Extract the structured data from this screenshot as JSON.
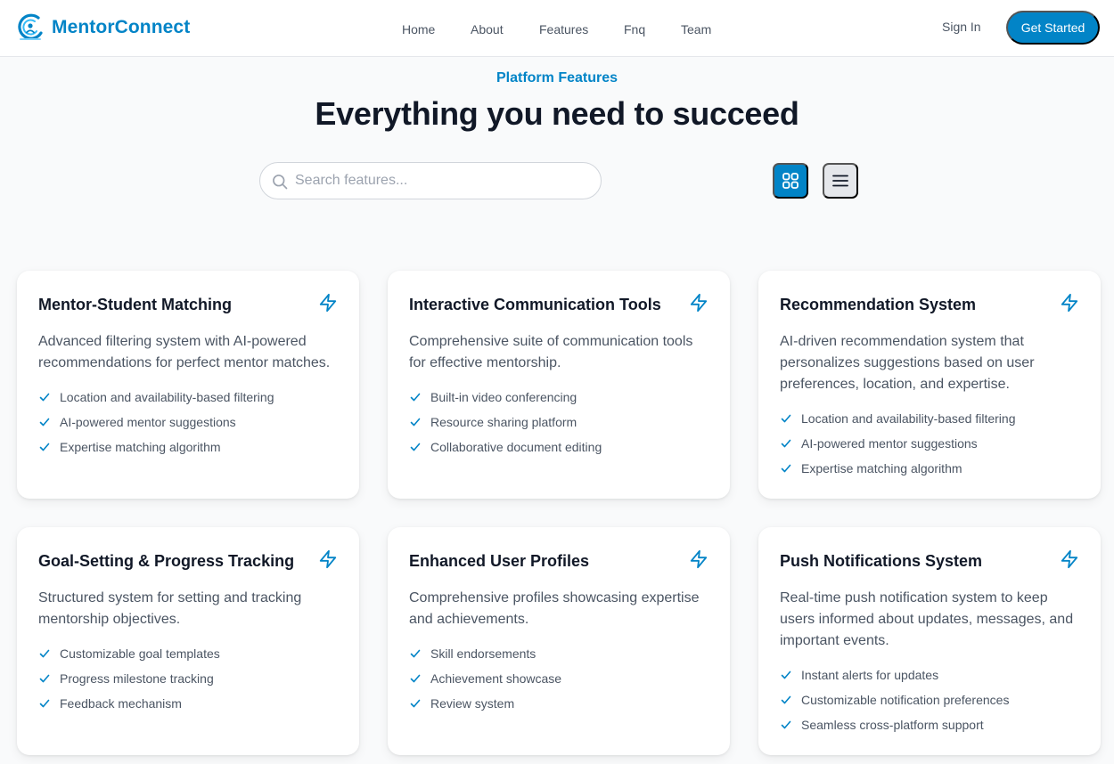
{
  "brand": {
    "name": "MentorConnect",
    "logo_icon": "mentorconnect-logo-icon"
  },
  "nav": {
    "links": [
      "Home",
      "About",
      "Features",
      "Fnq",
      "Team"
    ],
    "sign_in": "Sign In",
    "cta": "Get Started"
  },
  "section": {
    "eyebrow": "Platform Features",
    "title": "Everything you need to succeed"
  },
  "search": {
    "placeholder": "Search features...",
    "value": ""
  },
  "view_toggle": {
    "active": "grid",
    "options": [
      "grid",
      "list"
    ]
  },
  "colors": {
    "accent": "#0284c7",
    "heading": "#111827",
    "body_text": "#4b5563",
    "page_bg": "#f9fafb",
    "card_bg": "#ffffff",
    "toggle_inactive": "#e5e7eb"
  },
  "features": [
    {
      "title": "Mentor-Student Matching",
      "icon": "lightning-bolt-icon",
      "description": "Advanced filtering system with AI-powered recommendations for perfect mentor matches.",
      "items": [
        "Location and availability-based filtering",
        "AI-powered mentor suggestions",
        "Expertise matching algorithm"
      ]
    },
    {
      "title": "Interactive Communication Tools",
      "icon": "lightning-bolt-icon",
      "description": "Comprehensive suite of communication tools for effective mentorship.",
      "items": [
        "Built-in video conferencing",
        "Resource sharing platform",
        "Collaborative document editing"
      ]
    },
    {
      "title": "Recommendation System",
      "icon": "lightning-bolt-icon",
      "description": "AI-driven recommendation system that personalizes suggestions based on user preferences, location, and expertise.",
      "items": [
        "Location and availability-based filtering",
        "AI-powered mentor suggestions",
        "Expertise matching algorithm"
      ]
    },
    {
      "title": "Goal-Setting & Progress Tracking",
      "icon": "lightning-bolt-icon",
      "description": "Structured system for setting and tracking mentorship objectives.",
      "items": [
        "Customizable goal templates",
        "Progress milestone tracking",
        "Feedback mechanism"
      ]
    },
    {
      "title": "Enhanced User Profiles",
      "icon": "lightning-bolt-icon",
      "description": "Comprehensive profiles showcasing expertise and achievements.",
      "items": [
        "Skill endorsements",
        "Achievement showcase",
        "Review system"
      ]
    },
    {
      "title": "Push Notifications System",
      "icon": "lightning-bolt-icon",
      "description": "Real-time push notification system to keep users informed about updates, messages, and important events.",
      "items": [
        "Instant alerts for updates",
        "Customizable notification preferences",
        "Seamless cross-platform support"
      ]
    }
  ]
}
